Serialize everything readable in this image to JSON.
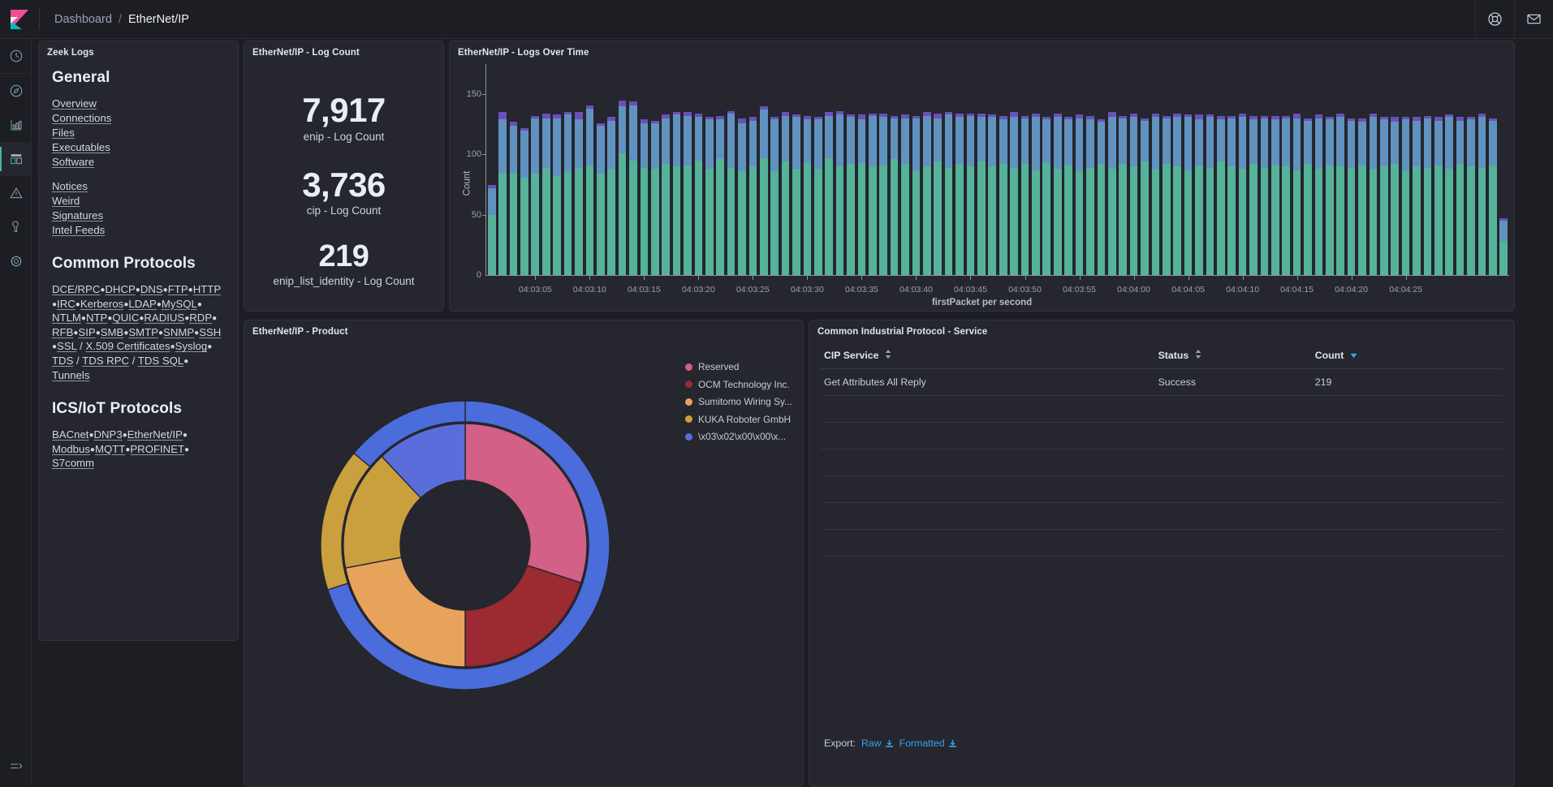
{
  "header": {
    "logo": "kibana-logo",
    "breadcrumb": {
      "root": "Dashboard",
      "separator": "/",
      "current": "EtherNet/IP"
    },
    "icons": [
      {
        "name": "help-icon",
        "glyph": "life-ring"
      },
      {
        "name": "mail-icon",
        "glyph": "envelope"
      }
    ]
  },
  "rail": {
    "items": [
      {
        "name": "sidebar-item-recent",
        "icon": "clock-icon",
        "active": false
      },
      {
        "name": "sidebar-item-discover",
        "icon": "compass-icon",
        "active": false
      },
      {
        "name": "sidebar-item-visualize",
        "icon": "bar-chart-icon",
        "active": false
      },
      {
        "name": "sidebar-item-dashboard",
        "icon": "dashboard-icon",
        "active": true
      },
      {
        "name": "sidebar-item-alerts",
        "icon": "warning-triangle-icon",
        "active": false
      },
      {
        "name": "sidebar-item-devtools",
        "icon": "wrench-icon",
        "active": false
      },
      {
        "name": "sidebar-item-management",
        "icon": "gear-icon",
        "active": false
      }
    ],
    "collapse": {
      "name": "collapse-nav-icon",
      "icon": "arrow-to-right-icon"
    }
  },
  "zeek_panel": {
    "title": "Zeek Logs",
    "sections": [
      {
        "heading": "General",
        "groups": [
          {
            "links": [
              "Overview",
              "Connections",
              "Files",
              "Executables",
              "Software"
            ]
          },
          {
            "links": [
              "Notices",
              "Weird",
              "Signatures",
              "Intel Feeds"
            ]
          }
        ]
      }
    ],
    "common_protocols": {
      "heading": "Common Protocols",
      "items": [
        "DCE/RPC",
        "DHCP",
        "DNS",
        "FTP",
        "HTTP",
        "IRC",
        "Kerberos",
        "LDAP",
        "MySQL",
        "NTLM",
        "NTP",
        "QUIC",
        "RADIUS",
        "RDP",
        "RFB",
        "SIP",
        "SMB",
        "SMTP",
        "SNMP",
        "SSH",
        "SSL / X.509 Certificates",
        "Syslog",
        "TDS / TDS RPC / TDS SQL",
        "Tunnels"
      ]
    },
    "ics_protocols": {
      "heading": "ICS/IoT Protocols",
      "items": [
        "BACnet",
        "DNP3",
        "EtherNet/IP",
        "Modbus",
        "MQTT",
        "PROFINET",
        "S7comm"
      ]
    }
  },
  "metric_panel": {
    "title": "EtherNet/IP - Log Count",
    "metrics": [
      {
        "value": "7,917",
        "label": "enip - Log Count"
      },
      {
        "value": "3,736",
        "label": "cip - Log Count"
      },
      {
        "value": "219",
        "label": "enip_list_identity - Log Count"
      }
    ]
  },
  "histogram_panel": {
    "title": "EtherNet/IP - Logs Over Time"
  },
  "pie_panel": {
    "title": "EtherNet/IP - Product"
  },
  "table_panel": {
    "title": "Common Industrial Protocol - Service",
    "columns": [
      {
        "label": "CIP Service",
        "sort": "none"
      },
      {
        "label": "Status",
        "sort": "none"
      },
      {
        "label": "Count",
        "sort": "desc"
      }
    ],
    "rows": [
      {
        "service": "Get Attributes All Reply",
        "status": "Success",
        "count": "219"
      }
    ],
    "empty_rows": 6,
    "export": {
      "label": "Export:",
      "raw": "Raw",
      "formatted": "Formatted"
    }
  },
  "chart_data": [
    {
      "type": "bar",
      "id": "logs-over-time",
      "title": "EtherNet/IP - Logs Over Time",
      "xlabel": "firstPacket per second",
      "ylabel": "Count",
      "stacked": true,
      "ylim": [
        0,
        175
      ],
      "yticks": [
        0,
        50,
        100,
        150
      ],
      "grid": false,
      "legend_position": "none",
      "xticks": [
        "04:03:05",
        "04:03:10",
        "04:03:15",
        "04:03:20",
        "04:03:25",
        "04:03:30",
        "04:03:35",
        "04:03:40",
        "04:03:45",
        "04:03:50",
        "04:03:55",
        "04:04:00",
        "04:04:05",
        "04:04:10",
        "04:04:15",
        "04:04:20",
        "04:04:25"
      ],
      "series": [
        {
          "name": "enip",
          "color": "#54b399",
          "values": [
            50,
            85,
            85,
            81,
            84,
            89,
            82,
            86,
            89,
            91,
            84,
            88,
            101,
            95,
            89,
            88,
            92,
            90,
            91,
            95,
            88,
            96,
            89,
            86,
            90,
            97,
            86,
            94,
            88,
            93,
            88,
            97,
            90,
            92,
            93,
            90,
            91,
            96,
            92,
            86,
            90,
            94,
            89,
            92,
            90,
            94,
            90,
            92,
            89,
            92,
            87,
            93,
            88,
            91,
            86,
            89,
            92,
            88,
            92,
            90,
            94,
            88,
            92,
            90,
            87,
            91,
            89,
            94,
            90,
            88,
            92,
            89,
            91,
            90,
            87,
            92,
            88,
            91,
            90,
            89,
            91,
            88,
            90,
            92,
            87,
            90,
            89,
            91,
            88,
            92,
            90,
            89,
            91,
            28
          ]
        },
        {
          "name": "cip",
          "color": "#6092c0",
          "values": [
            22,
            44,
            39,
            39,
            46,
            41,
            48,
            47,
            40,
            47,
            40,
            40,
            39,
            46,
            37,
            38,
            38,
            43,
            41,
            36,
            41,
            33,
            45,
            40,
            38,
            40,
            43,
            38,
            43,
            36,
            41,
            35,
            43,
            39,
            36,
            42,
            40,
            34,
            38,
            44,
            42,
            36,
            44,
            39,
            42,
            37,
            41,
            37,
            42,
            38,
            44,
            36,
            43,
            38,
            44,
            40,
            35,
            43,
            38,
            41,
            34,
            43,
            38,
            41,
            44,
            38,
            42,
            35,
            40,
            43,
            37,
            41,
            38,
            40,
            43,
            36,
            42,
            38,
            41,
            39,
            36,
            43,
            39,
            35,
            42,
            38,
            41,
            37,
            43,
            36,
            39,
            42,
            37,
            17
          ]
        },
        {
          "name": "enip_list_identity",
          "color": "#6b4fbb",
          "values": [
            3,
            6,
            3,
            2,
            2,
            4,
            3,
            2,
            6,
            3,
            2,
            3,
            5,
            3,
            3,
            2,
            3,
            2,
            3,
            3,
            2,
            3,
            2,
            4,
            3,
            3,
            2,
            3,
            2,
            3,
            2,
            3,
            3,
            2,
            4,
            2,
            3,
            2,
            3,
            2,
            3,
            4,
            2,
            3,
            2,
            3,
            2,
            3,
            4,
            2,
            3,
            2,
            3,
            2,
            3,
            3,
            2,
            4,
            2,
            3,
            2,
            3,
            2,
            3,
            2,
            4,
            2,
            3,
            2,
            3,
            3,
            2,
            3,
            2,
            4,
            2,
            3,
            2,
            3,
            2,
            3,
            3,
            2,
            4,
            2,
            3,
            2,
            3,
            2,
            3,
            2,
            3,
            2,
            2
          ]
        }
      ]
    },
    {
      "type": "pie",
      "id": "ethernetip-product",
      "title": "EtherNet/IP - Product",
      "donut": true,
      "legend_position": "right",
      "rings": [
        {
          "name": "inner",
          "slices": [
            {
              "label": "Reserved",
              "color": "#d36086",
              "value": 30
            },
            {
              "label": "OCM Technology Inc.",
              "color": "#9b2a33",
              "value": 20
            },
            {
              "label": "Sumitomo Wiring Sy...",
              "color": "#e7a35c",
              "value": 22
            },
            {
              "label": "KUKA Roboter GmbH",
              "color": "#ca9f3e",
              "value": 16
            },
            {
              "label": "\\x03\\x02\\x00\\x00\\x...",
              "color": "#5a6ddb",
              "value": 12
            }
          ]
        },
        {
          "name": "outer",
          "slices": [
            {
              "label": "\\x03\\x02\\x00\\x00\\x...",
              "color": "#4a6ddb",
              "value": 70
            },
            {
              "label": "KUKA Roboter GmbH",
              "color": "#ca9f3e",
              "value": 16
            },
            {
              "label": "\\x03\\x02\\x00\\x00\\x...",
              "color": "#4a6ddb",
              "value": 14
            }
          ]
        }
      ],
      "legend": [
        {
          "label": "Reserved",
          "color": "#d36086"
        },
        {
          "label": "OCM Technology Inc.",
          "color": "#9b2a33"
        },
        {
          "label": "Sumitomo Wiring Sy...",
          "color": "#e7a35c"
        },
        {
          "label": "KUKA Roboter GmbH",
          "color": "#ca9f3e"
        },
        {
          "label": "\\x03\\x02\\x00\\x00\\x...",
          "color": "#5a6ddb"
        }
      ]
    }
  ]
}
